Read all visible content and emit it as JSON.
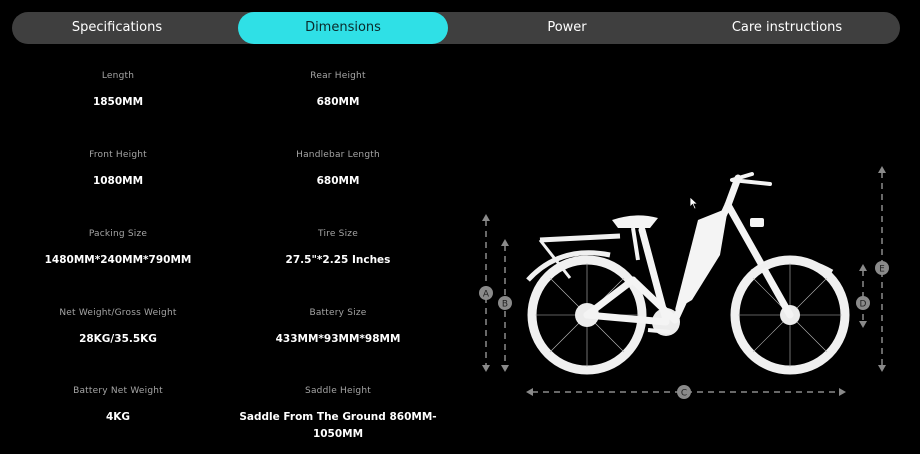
{
  "tabs": [
    {
      "label": "Specifications",
      "active": false
    },
    {
      "label": "Dimensions",
      "active": true
    },
    {
      "label": "Power",
      "active": false
    },
    {
      "label": "Care instructions",
      "active": false
    }
  ],
  "specs": [
    {
      "label": "Length",
      "value": "1850MM"
    },
    {
      "label": "Rear Height",
      "value": "680MM"
    },
    {
      "label": "Front Height",
      "value": "1080MM"
    },
    {
      "label": "Handlebar Length",
      "value": "680MM"
    },
    {
      "label": "Packing Size",
      "value": "1480MM*240MM*790MM"
    },
    {
      "label": "Tire Size",
      "value": "27.5\"*2.25 Inches"
    },
    {
      "label": "Net Weight/Gross Weight",
      "value": "28KG/35.5KG"
    },
    {
      "label": "Battery Size",
      "value": "433MM*93MM*98MM"
    },
    {
      "label": "Battery Net Weight",
      "value": "4KG"
    },
    {
      "label": "Saddle Height",
      "value": "Saddle From The Ground 860MM-1050MM"
    }
  ],
  "diagram": {
    "markers": [
      "A",
      "B",
      "C",
      "D",
      "E"
    ],
    "colors": {
      "accent": "#2fe0e6",
      "tabbar": "#3f3f3f",
      "line": "#8a8a8a"
    }
  }
}
